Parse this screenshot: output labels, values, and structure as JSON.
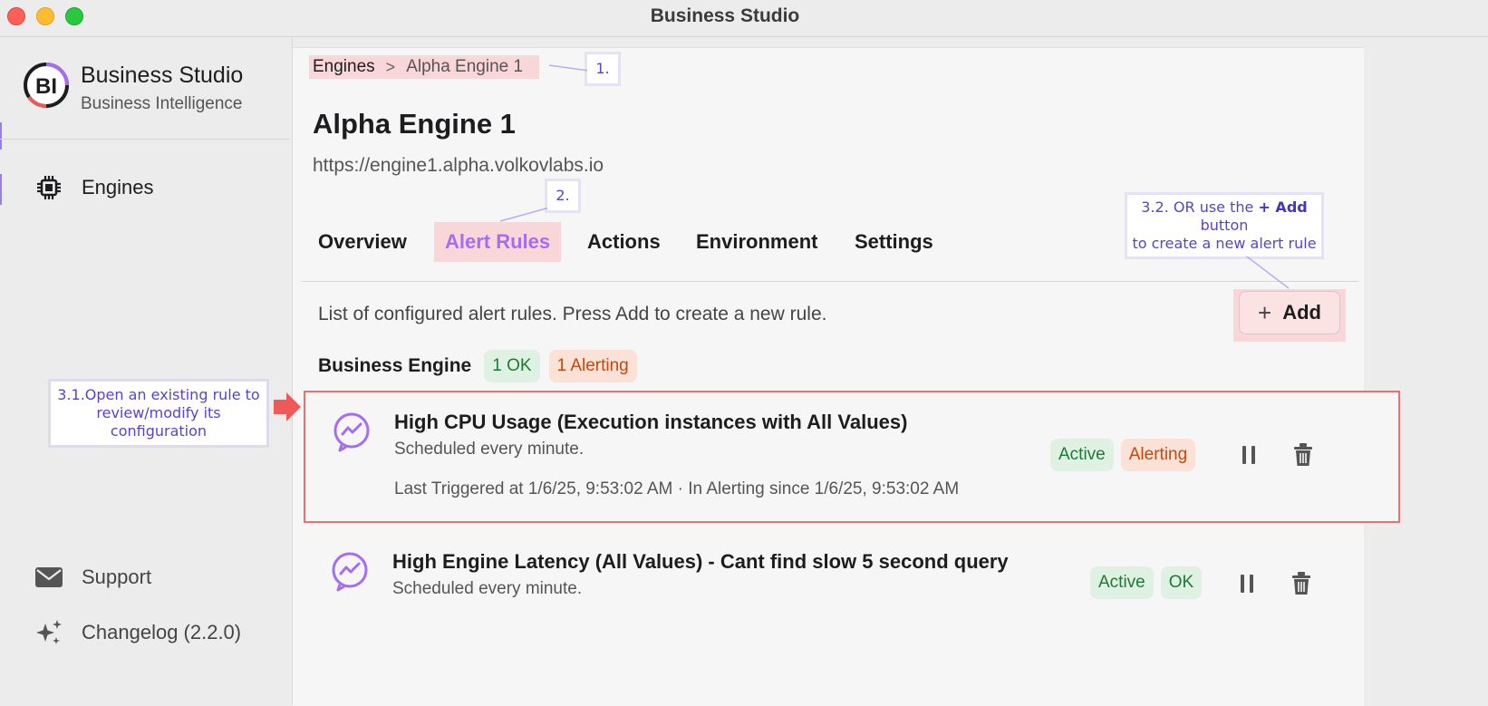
{
  "window": {
    "title": "Business Studio"
  },
  "sidebar": {
    "brand_name": "Business Studio",
    "brand_subtitle": "Business Intelligence",
    "logo_text": "BI",
    "items": [
      {
        "label": "Engines",
        "icon": "chip-icon"
      },
      {
        "label": "Support",
        "icon": "mail-icon"
      },
      {
        "label": "Changelog (2.2.0)",
        "icon": "sparkles-icon"
      }
    ]
  },
  "breadcrumb": {
    "items": [
      "Engines",
      "Alpha Engine 1"
    ],
    "separator": ">"
  },
  "page": {
    "title": "Alpha Engine 1",
    "url": "https://engine1.alpha.volkovlabs.io"
  },
  "tabs": [
    "Overview",
    "Alert Rules",
    "Actions",
    "Environment",
    "Settings"
  ],
  "active_tab": "Alert Rules",
  "alert_rules": {
    "description": "List of configured alert rules. Press Add to create a new rule.",
    "add_label": "Add",
    "add_symbol": "+",
    "group": {
      "name": "Business Engine",
      "ok_badge": "1 OK",
      "alerting_badge": "1 Alerting"
    },
    "rules": [
      {
        "title": "High CPU Usage (Execution instances with All Values)",
        "schedule": "Scheduled every minute.",
        "meta": "Last Triggered at 1/6/25, 9:53:02 AM  ·  In Alerting since 1/6/25, 9:53:02 AM",
        "badges": [
          "Active",
          "Alerting"
        ]
      },
      {
        "title": "High Engine Latency (All Values) - Cant find slow 5 second query",
        "schedule": "Scheduled every minute.",
        "badges": [
          "Active",
          "OK"
        ]
      }
    ]
  },
  "annotations": {
    "a1": "1.",
    "a2": "2.",
    "a32_prefix": "3.2. OR use the ",
    "a32_bold": "+ Add",
    "a32_suffix": " button",
    "a32_line2": "to create a new alert rule",
    "a31_line1": "3.1.Open an existing rule to",
    "a31_line2": "review/modify its configuration"
  },
  "colors": {
    "highlight": "#f9d6d8",
    "accent": "#a56ef0",
    "ok_bg": "#dff1e2",
    "ok_text": "#1d7a34",
    "alert_bg": "#fbe1d6",
    "alert_text": "#c3490e",
    "rule_border": "#ee6f6f",
    "annotation": "#5b43c8"
  }
}
